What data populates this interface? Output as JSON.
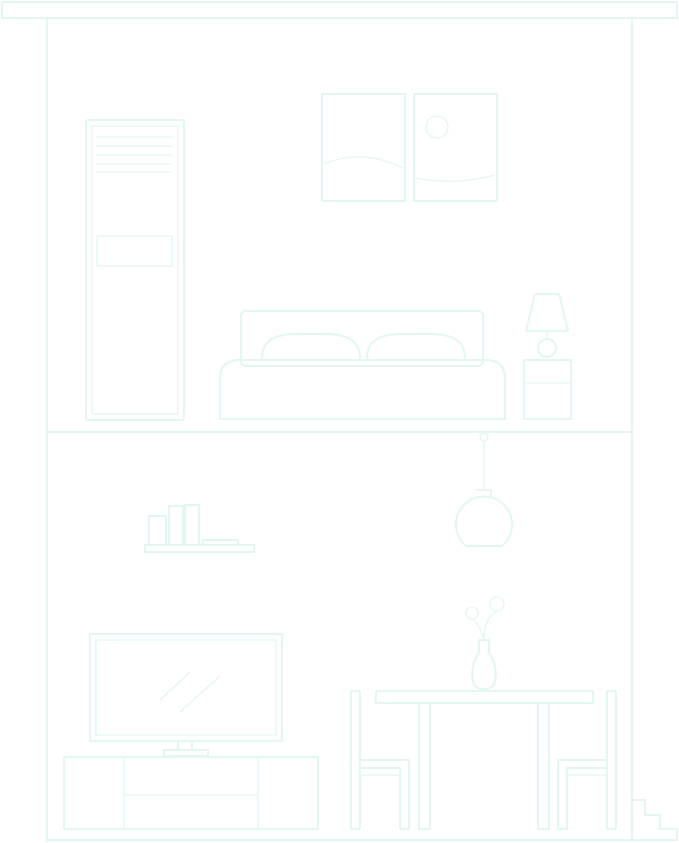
{
  "illustration": {
    "kind": "two-storey house interior line drawing",
    "stroke_color": "#e3f6f1",
    "background_color": "#ffffff",
    "upper_floor": {
      "room": "bedroom",
      "items": [
        "wardrobe",
        "framed-pictures",
        "double-bed",
        "bedside-table",
        "table-lamp"
      ]
    },
    "lower_floor": {
      "room": "living-dining",
      "items": [
        "wall-shelf",
        "books",
        "pendant-lamp",
        "tv",
        "tv-cabinet",
        "flower-vase",
        "dining-table",
        "dining-chairs",
        "stairs"
      ]
    }
  }
}
